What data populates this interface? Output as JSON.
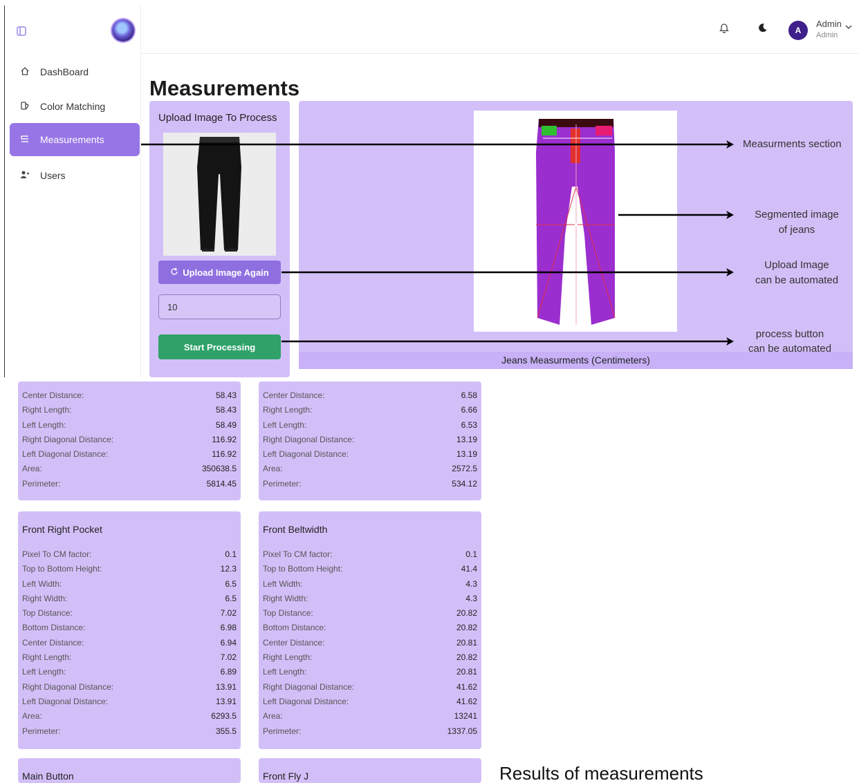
{
  "sidebar": {
    "items": [
      {
        "label": "DashBoard",
        "icon": "home-icon"
      },
      {
        "label": "Color Matching",
        "icon": "swatch-icon"
      },
      {
        "label": "Measurements",
        "icon": "ruler-icon",
        "active": true
      },
      {
        "label": "Users",
        "icon": "user-add-icon"
      }
    ]
  },
  "header": {
    "avatar_initial": "A",
    "user_name": "Admin",
    "user_role": "Admin"
  },
  "page": {
    "title": "Measurements"
  },
  "upload": {
    "title": "Upload Image To Process",
    "upload_again_label": "Upload Image Again",
    "count_value": "10",
    "start_label": "Start Processing"
  },
  "result": {
    "caption": "Jeans Measurments (Centimeters)"
  },
  "annotations": {
    "measurements_section": "Measurments section",
    "segmented_line1": "Segmented image",
    "segmented_line2": "of jeans",
    "upload_line1": "Upload Image",
    "upload_line2": "can be automated",
    "process_line1": "process button",
    "process_line2": "can be automated"
  },
  "tables": {
    "partial_left": {
      "rows": [
        {
          "label": "Center Distance:",
          "value": "58.43"
        },
        {
          "label": "Right Length:",
          "value": "58.43"
        },
        {
          "label": "Left Length:",
          "value": "58.49"
        },
        {
          "label": "Right Diagonal Distance:",
          "value": "116.92"
        },
        {
          "label": "Left Diagonal Distance:",
          "value": "116.92"
        },
        {
          "label": "Area:",
          "value": "350638.5"
        },
        {
          "label": "Perimeter:",
          "value": "5814.45"
        }
      ]
    },
    "partial_right": {
      "rows": [
        {
          "label": "Center Distance:",
          "value": "6.58"
        },
        {
          "label": "Right Length:",
          "value": "6.66"
        },
        {
          "label": "Left Length:",
          "value": "6.53"
        },
        {
          "label": "Right Diagonal Distance:",
          "value": "13.19"
        },
        {
          "label": "Left Diagonal Distance:",
          "value": "13.19"
        },
        {
          "label": "Area:",
          "value": "2572.5"
        },
        {
          "label": "Perimeter:",
          "value": "534.12"
        }
      ]
    },
    "front_right_pocket": {
      "title": "Front Right Pocket",
      "rows": [
        {
          "label": "Pixel To CM factor:",
          "value": "0.1"
        },
        {
          "label": "Top to Bottom Height:",
          "value": "12.3"
        },
        {
          "label": "Left Width:",
          "value": "6.5"
        },
        {
          "label": "Right Width:",
          "value": "6.5"
        },
        {
          "label": "Top Distance:",
          "value": "7.02"
        },
        {
          "label": "Bottom Distance:",
          "value": "6.98"
        },
        {
          "label": "Center Distance:",
          "value": "6.94"
        },
        {
          "label": "Right Length:",
          "value": "7.02"
        },
        {
          "label": "Left Length:",
          "value": "6.89"
        },
        {
          "label": "Right Diagonal Distance:",
          "value": "13.91"
        },
        {
          "label": "Left Diagonal Distance:",
          "value": "13.91"
        },
        {
          "label": "Area:",
          "value": "6293.5"
        },
        {
          "label": "Perimeter:",
          "value": "355.5"
        }
      ]
    },
    "front_beltwidth": {
      "title": "Front Beltwidth",
      "rows": [
        {
          "label": "Pixel To CM factor:",
          "value": "0.1"
        },
        {
          "label": "Top to Bottom Height:",
          "value": "41.4"
        },
        {
          "label": "Left Width:",
          "value": "4.3"
        },
        {
          "label": "Right Width:",
          "value": "4.3"
        },
        {
          "label": "Top Distance:",
          "value": "20.82"
        },
        {
          "label": "Bottom Distance:",
          "value": "20.82"
        },
        {
          "label": "Center Distance:",
          "value": "20.81"
        },
        {
          "label": "Right Length:",
          "value": "20.82"
        },
        {
          "label": "Left Length:",
          "value": "20.81"
        },
        {
          "label": "Right Diagonal Distance:",
          "value": "41.62"
        },
        {
          "label": "Left Diagonal Distance:",
          "value": "41.62"
        },
        {
          "label": "Area:",
          "value": "13241"
        },
        {
          "label": "Perimeter:",
          "value": "1337.05"
        }
      ]
    },
    "main_button": {
      "title": "Main Button"
    },
    "front_fly": {
      "title": "Front Fly J"
    }
  },
  "results_caption": "Results of measurements",
  "colors": {
    "accent": "#9775e6",
    "card": "#d3bff8",
    "start_button": "#2ea268",
    "avatar": "#3f1f8a"
  }
}
